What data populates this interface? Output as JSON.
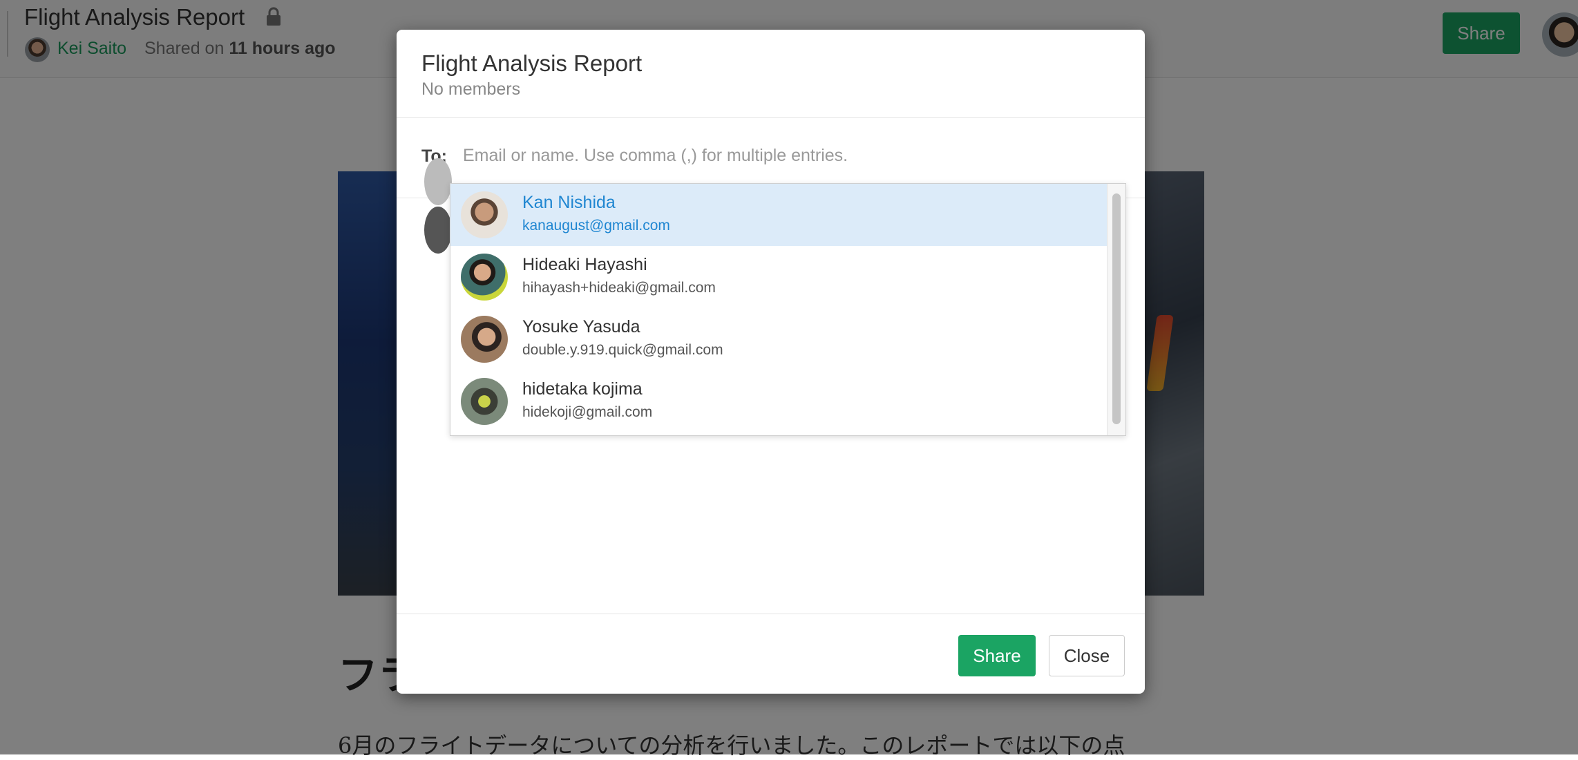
{
  "page": {
    "title": "Flight Analysis Report",
    "author": "Kei Saito",
    "shared_prefix": "Shared on",
    "shared_when": "11 hours ago",
    "share_label": "Share",
    "heading_visible": "フラ",
    "paragraph_visible": "6月のフライトデータについての分析を行いました。このレポートでは以下の点"
  },
  "modal": {
    "title": "Flight Analysis Report",
    "subtitle": "No members",
    "to_label": "To:",
    "to_placeholder": "Email or name. Use comma (,) for multiple entries.",
    "share_label": "Share",
    "close_label": "Close"
  },
  "suggestions": [
    {
      "name": "Kan Nishida",
      "email": "kanaugust@gmail.com",
      "active": true
    },
    {
      "name": "Hideaki Hayashi",
      "email": "hihayash+hideaki@gmail.com",
      "active": false
    },
    {
      "name": "Yosuke Yasuda",
      "email": "double.y.919.quick@gmail.com",
      "active": false
    },
    {
      "name": "hidetaka kojima",
      "email": "hidekoji@gmail.com",
      "active": false
    }
  ],
  "colors": {
    "accent_green": "#1ba463",
    "author_link": "#1a9b5c",
    "highlight_bg": "#dcebf9",
    "highlight_text": "#1f86d1"
  }
}
